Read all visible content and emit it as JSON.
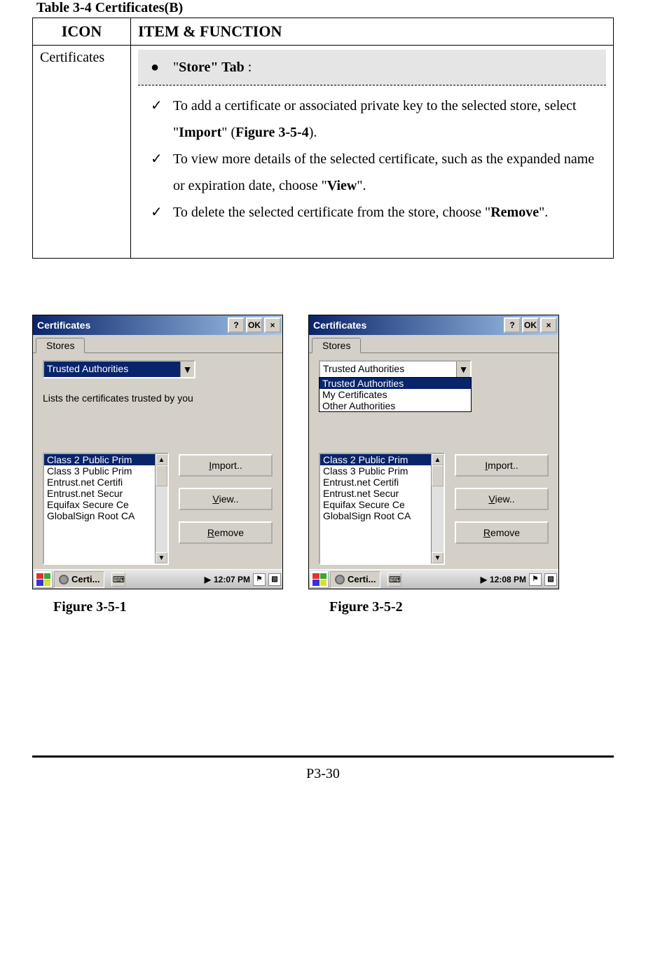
{
  "tableTitle": "Table 3-4 Certificates(B)",
  "headers": {
    "icon": "ICON",
    "func": "ITEM & FUNCTION"
  },
  "iconCell": "Certificates",
  "storeTab": {
    "bullet": "●",
    "prefix": "\"",
    "name": "Store",
    "suffix": "\" Tab",
    "colon": " :"
  },
  "items": [
    {
      "bullet": "✓",
      "p1": "To add a certificate or associated private key to the selected store, select \"",
      "b1": "Import",
      "p2": "\" (",
      "b2": "Figure 3-5-4",
      "p3": ")."
    },
    {
      "bullet": "✓",
      "p1": "To view more details of the selected certificate, such as the expanded name or expiration date, choose \"",
      "b1": "View",
      "p2": "\".",
      "b2": "",
      "p3": ""
    },
    {
      "bullet": "✓",
      "p1": "To delete the selected certificate from the store, choose \"",
      "b1": "Remove",
      "p2": "\".",
      "b2": "",
      "p3": ""
    }
  ],
  "win": {
    "title": "Certificates",
    "help": "?",
    "ok": "OK",
    "close": "×",
    "tab": "Stores",
    "comboSel": "Trusted Authorities",
    "options": [
      "Trusted Authorities",
      "My Certificates",
      "Other Authorities"
    ],
    "desc": "Lists the certificates trusted by you",
    "certs": [
      "Class 2 Public Prim",
      "Class 3 Public Prim",
      "Entrust.net Certifi",
      "Entrust.net Secur",
      "Equifax Secure Ce",
      "GlobalSign Root CA"
    ],
    "btnImport": "mport..",
    "btnImportU": "I",
    "btnView": "iew..",
    "btnViewU": "V",
    "btnRemove": "emove",
    "btnRemoveU": "R",
    "task": "Certi...",
    "time1": "12:07 PM",
    "time2": "12:08 PM"
  },
  "captions": {
    "left": "Figure 3-5-1",
    "right": "Figure 3-5-2"
  },
  "pageNum": "P3-30"
}
